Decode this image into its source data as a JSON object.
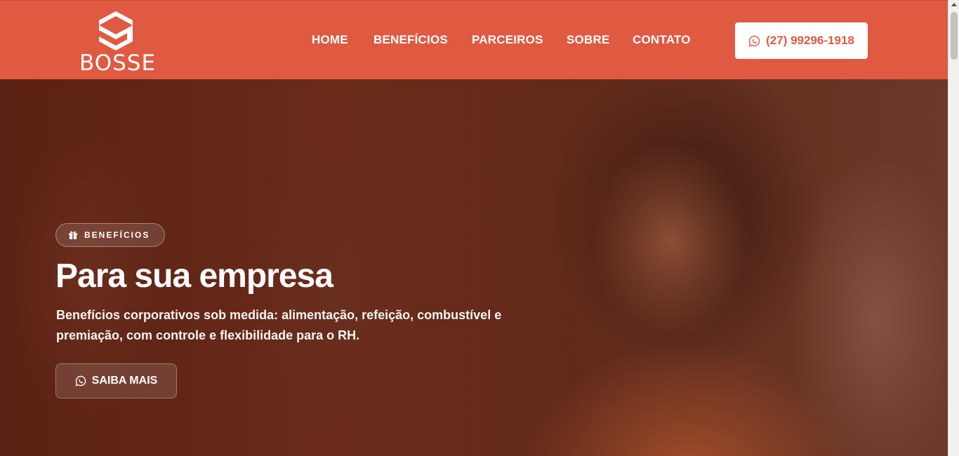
{
  "brand": {
    "name": "BOSSE",
    "logo_icon": "s-hexagon-logo-icon"
  },
  "nav": {
    "items": [
      {
        "label": "HOME"
      },
      {
        "label": "BENEFÍCIOS"
      },
      {
        "label": "PARCEIROS"
      },
      {
        "label": "SOBRE"
      },
      {
        "label": "CONTATO"
      }
    ],
    "phone": {
      "label": "(27) 99296-1918",
      "icon": "whatsapp-icon"
    }
  },
  "hero": {
    "badge": {
      "label": "BENEFÍCIOS",
      "icon": "gift-icon"
    },
    "title": "Para sua empresa",
    "description": "Benefícios corporativos sob medida: alimentação, refeição, combustível e premiação, com controle e flexibilidade para o RH.",
    "cta": {
      "label": "SAIBA MAIS",
      "icon": "whatsapp-icon"
    }
  },
  "colors": {
    "brand": "#e05a42",
    "white": "#ffffff"
  }
}
